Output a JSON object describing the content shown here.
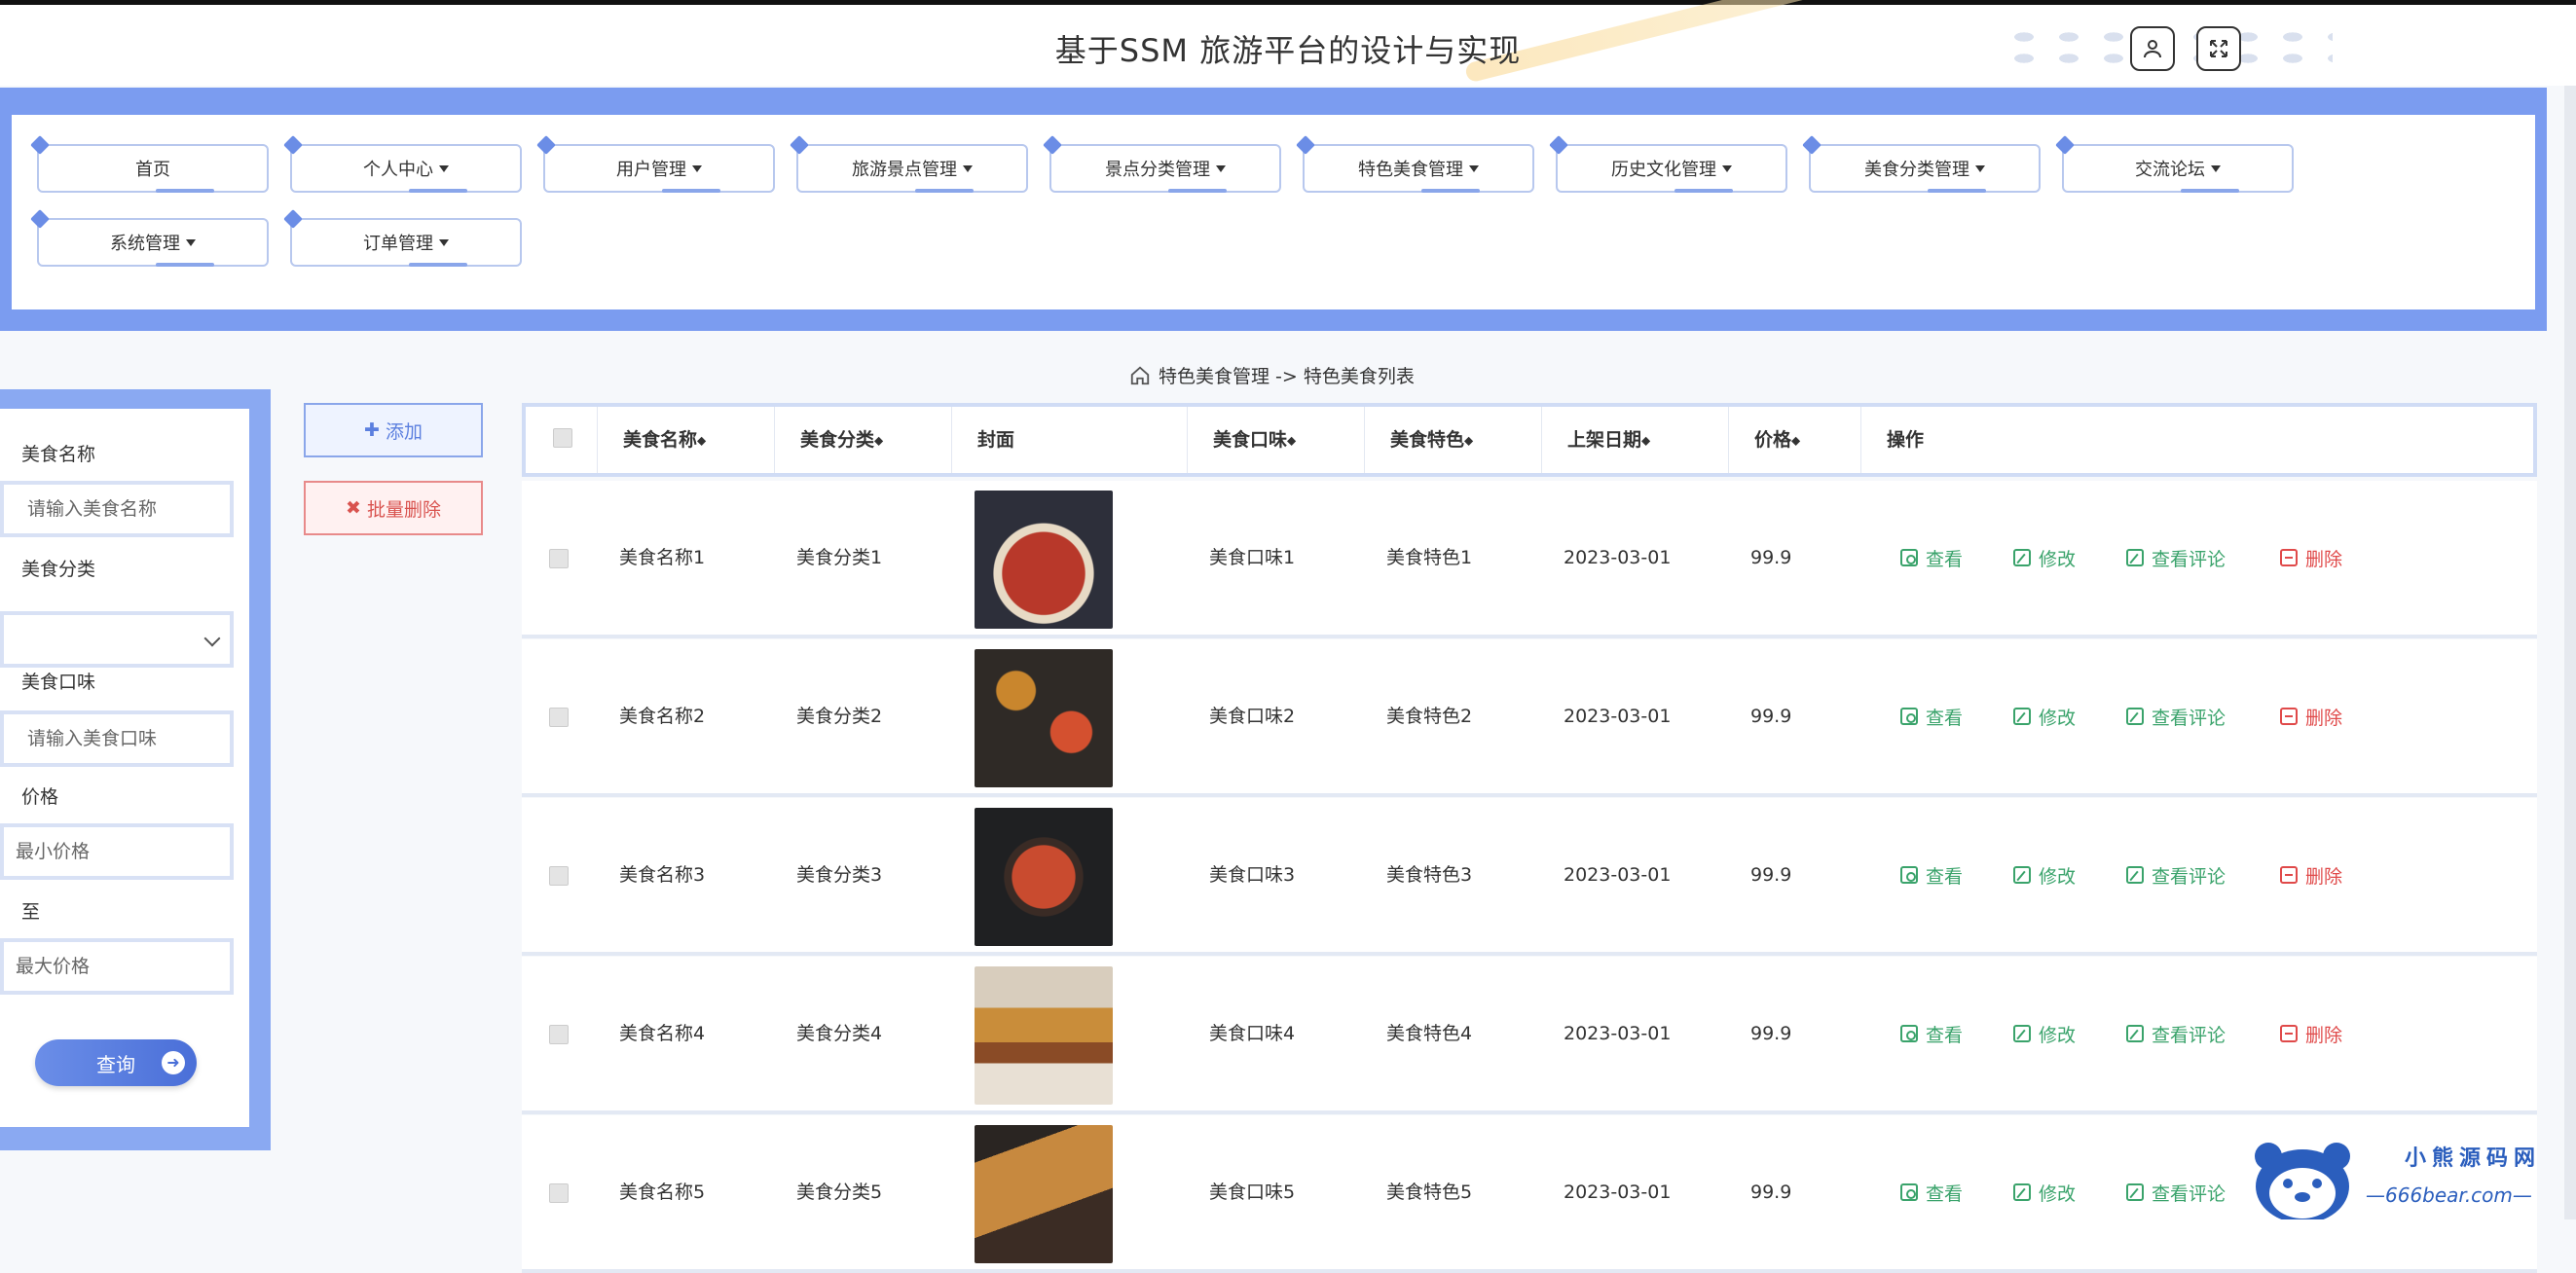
{
  "header": {
    "title": "基于SSM 旅游平台的设计与实现",
    "user_icon": "user-icon",
    "fullscreen_icon": "fullscreen-icon"
  },
  "nav": {
    "items": [
      {
        "label": "首页",
        "dropdown": false
      },
      {
        "label": "个人中心",
        "dropdown": true
      },
      {
        "label": "用户管理",
        "dropdown": true
      },
      {
        "label": "旅游景点管理",
        "dropdown": true
      },
      {
        "label": "景点分类管理",
        "dropdown": true
      },
      {
        "label": "特色美食管理",
        "dropdown": true
      },
      {
        "label": "历史文化管理",
        "dropdown": true
      },
      {
        "label": "美食分类管理",
        "dropdown": true
      },
      {
        "label": "交流论坛",
        "dropdown": true
      },
      {
        "label": "系统管理",
        "dropdown": true
      },
      {
        "label": "订单管理",
        "dropdown": true
      }
    ]
  },
  "breadcrumb": {
    "home_icon": "home-icon",
    "text": "特色美食管理 -> 特色美食列表"
  },
  "search": {
    "name_label": "美食名称",
    "name_placeholder": "请输入美食名称",
    "category_label": "美食分类",
    "category_value": "",
    "taste_label": "美食口味",
    "taste_placeholder": "请输入美食口味",
    "price_label": "价格",
    "min_placeholder": "最小价格",
    "to_label": "至",
    "max_placeholder": "最大价格",
    "query_button": "查询"
  },
  "toolbar": {
    "add_label": "添加",
    "batch_delete_label": "批量删除"
  },
  "table": {
    "columns": [
      "美食名称",
      "美食分类",
      "封面",
      "美食口味",
      "美食特色",
      "上架日期",
      "价格",
      "操作"
    ],
    "actions": {
      "view": "查看",
      "edit": "修改",
      "comments": "查看评论",
      "delete": "删除"
    },
    "rows": [
      {
        "name": "美食名称1",
        "category": "美食分类1",
        "taste": "美食口味1",
        "feature": "美食特色1",
        "date": "2023-03-01",
        "price": "99.9"
      },
      {
        "name": "美食名称2",
        "category": "美食分类2",
        "taste": "美食口味2",
        "feature": "美食特色2",
        "date": "2023-03-01",
        "price": "99.9"
      },
      {
        "name": "美食名称3",
        "category": "美食分类3",
        "taste": "美食口味3",
        "feature": "美食特色3",
        "date": "2023-03-01",
        "price": "99.9"
      },
      {
        "name": "美食名称4",
        "category": "美食分类4",
        "taste": "美食口味4",
        "feature": "美食特色4",
        "date": "2023-03-01",
        "price": "99.9"
      },
      {
        "name": "美食名称5",
        "category": "美食分类5",
        "taste": "美食口味5",
        "feature": "美食特色5",
        "date": "2023-03-01",
        "price": "99.9"
      }
    ]
  },
  "watermark": {
    "line1": "小熊源码网",
    "line2": "—666bear.com—"
  },
  "colors": {
    "nav_border": "#7b9cf0",
    "accent": "#5b7fdf",
    "action_green": "#3aa36b",
    "action_red": "#e04a4a"
  }
}
